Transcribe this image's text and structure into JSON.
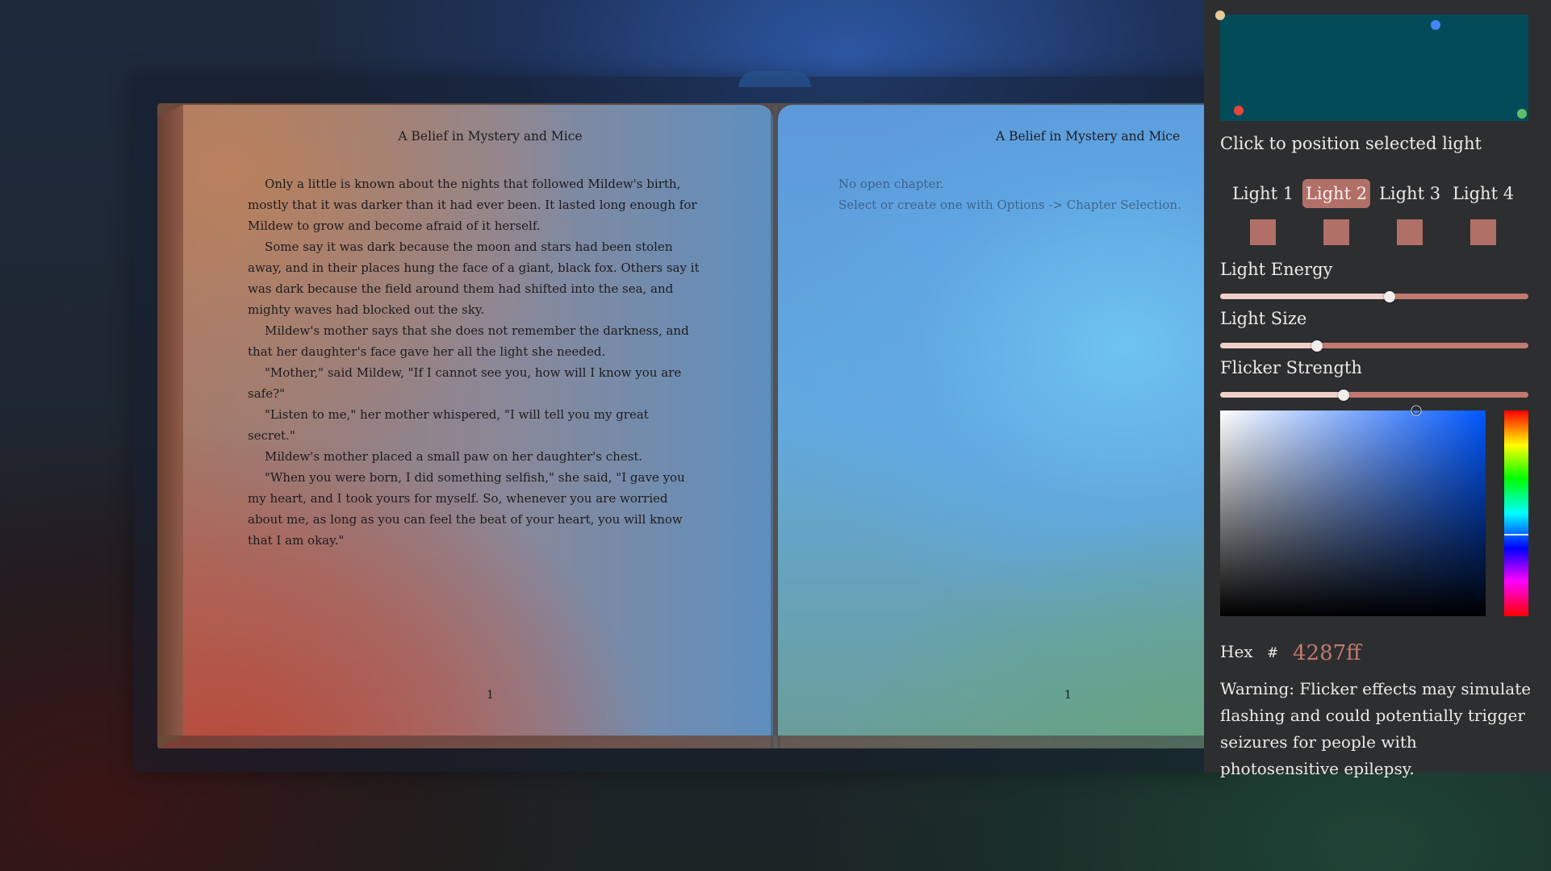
{
  "book": {
    "left_page": {
      "title": "A Belief in Mystery and Mice",
      "paragraphs": [
        "Only a little is known about the nights that followed Mildew's birth, mostly that it was darker than it had ever been. It lasted long enough for Mildew to grow and become afraid of it herself.",
        "Some say it was dark because the moon and stars had been stolen away, and in their places hung the face of a giant, black fox. Others say it was dark because the field around them had shifted into the sea, and mighty waves had blocked out the sky.",
        "Mildew's mother says that she does not remember the darkness, and that her daughter's face gave her all the light she needed.",
        "\"Mother,\" said Mildew, \"If I cannot see you, how will I know you are safe?\"",
        "\"Listen to me,\" her mother whispered, \"I will tell you my great secret.\"",
        "Mildew's mother placed a small paw on her daughter's chest.",
        "\"When you were born, I did something selfish,\" she said, \"I gave you my heart, and I took yours for myself. So, whenever you are worried about me, as long as you can feel the beat of your heart, you will know that I am okay.\""
      ],
      "page_number": "1"
    },
    "right_page": {
      "title": "A Belief in Mystery and Mice",
      "placeholder_line1": "No open chapter.",
      "placeholder_line2": "Select or create one with Options -> Chapter Selection.",
      "page_number": "1"
    }
  },
  "panel": {
    "hint": "Click to position selected light",
    "light_canvas_dots": [
      {
        "name": "light-1-dot",
        "color": "#e6cc99"
      },
      {
        "name": "light-2-dot",
        "color": "#4287ff"
      },
      {
        "name": "light-3-dot",
        "color": "#e8463c"
      },
      {
        "name": "light-4-dot",
        "color": "#5dbf6a"
      }
    ],
    "tabs": [
      {
        "label": "Light 1",
        "selected": false
      },
      {
        "label": "Light 2",
        "selected": true
      },
      {
        "label": "Light 3",
        "selected": false
      },
      {
        "label": "Light 4",
        "selected": false
      }
    ],
    "swatch_color": "#b07068",
    "sliders": [
      {
        "label": "Light Energy",
        "value": 0.55
      },
      {
        "label": "Light Size",
        "value": 0.315
      },
      {
        "label": "Flicker Strength",
        "value": 0.4
      }
    ],
    "color_picker": {
      "hue_color": "#0057ff",
      "saturation": 0.74,
      "brightness": 1.0,
      "hue_marker": 0.6
    },
    "hex_label": "Hex",
    "hex_hash": "#",
    "hex_value": "4287ff",
    "warning": "Warning: Flicker effects may simulate flashing and could potentially trigger seizures for people with photosensitive epilepsy."
  },
  "colors": {
    "panel_bg": "#2d2e30",
    "accent": "#c27a70",
    "canvas_bg": "#044b5a"
  }
}
